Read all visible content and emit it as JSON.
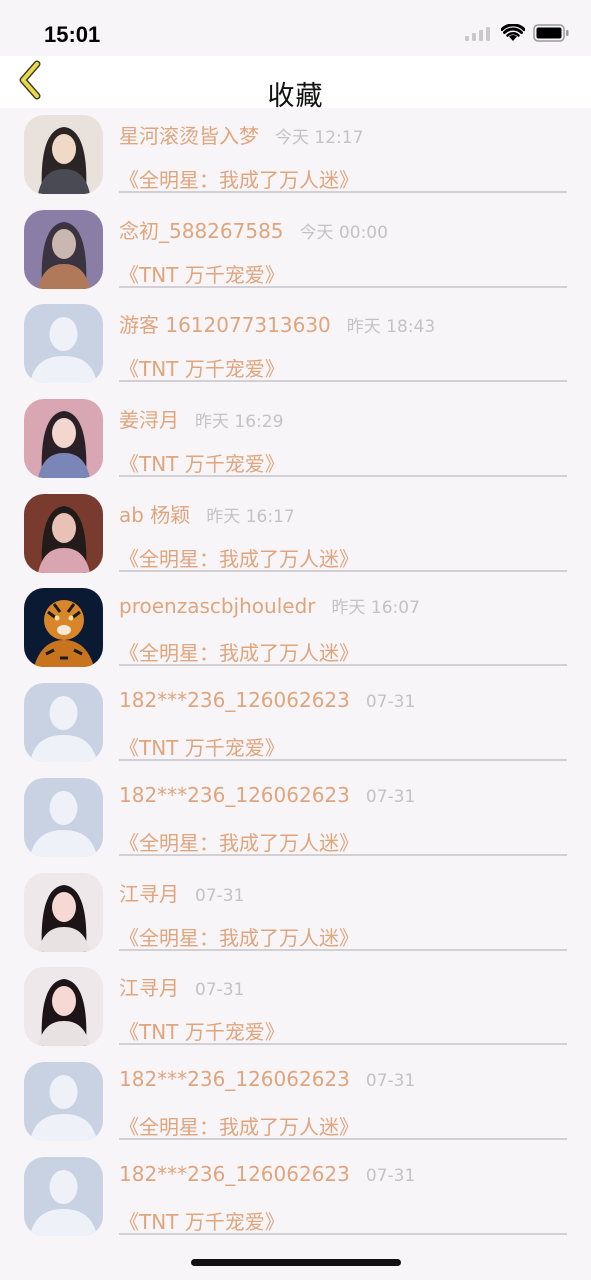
{
  "status_bar": {
    "time": "15:01"
  },
  "nav": {
    "title": "收藏"
  },
  "colors": {
    "accent": "#e0a57d",
    "time_gray": "#c5c2c6",
    "back_icon": "#e8d84c"
  },
  "items": [
    {
      "avatar": "portrait-illustration",
      "name": "星河滚烫皆入梦",
      "time": "今天 12:17",
      "book": "《全明星：我成了万人迷》"
    },
    {
      "avatar": "portrait-purple",
      "name": "念初_588267585",
      "time": "今天 00:00",
      "book": "《TNT 万千宠爱》"
    },
    {
      "avatar": "default-avatar",
      "name": "游客 1612077313630",
      "time": "昨天 18:43",
      "book": "《TNT 万千宠爱》"
    },
    {
      "avatar": "portrait-room",
      "name": "姜浔月",
      "time": "昨天 16:29",
      "book": "《TNT 万千宠爱》"
    },
    {
      "avatar": "portrait-wall",
      "name": "ab 杨颖",
      "time": "昨天 16:17",
      "book": "《全明星：我成了万人迷》"
    },
    {
      "avatar": "tiger",
      "name": "proenzascbjhouledr",
      "time": "昨天 16:07",
      "book": "《全明星：我成了万人迷》"
    },
    {
      "avatar": "default-avatar",
      "name": "182***236_126062623",
      "time": "07-31",
      "book": "《TNT 万千宠爱》"
    },
    {
      "avatar": "default-avatar",
      "name": "182***236_126062623",
      "time": "07-31",
      "book": "《全明星：我成了万人迷》"
    },
    {
      "avatar": "portrait-red",
      "name": "江寻月",
      "time": "07-31",
      "book": "《全明星：我成了万人迷》"
    },
    {
      "avatar": "portrait-red",
      "name": "江寻月",
      "time": "07-31",
      "book": "《TNT 万千宠爱》"
    },
    {
      "avatar": "default-avatar",
      "name": "182***236_126062623",
      "time": "07-31",
      "book": "《全明星：我成了万人迷》"
    },
    {
      "avatar": "default-avatar",
      "name": "182***236_126062623",
      "time": "07-31",
      "book": "《TNT 万千宠爱》"
    }
  ]
}
